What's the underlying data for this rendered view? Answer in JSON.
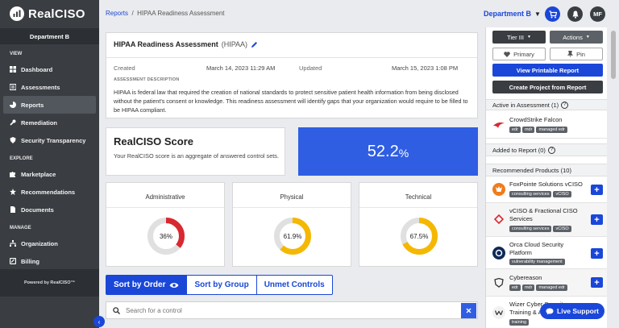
{
  "brand": {
    "name": "RealCISO"
  },
  "sidebar": {
    "department": "Department B",
    "sections": [
      {
        "label": "VIEW",
        "items": [
          {
            "label": "Dashboard",
            "icon": "dashboard-icon"
          },
          {
            "label": "Assessments",
            "icon": "list-icon"
          },
          {
            "label": "Reports",
            "icon": "chart-pie-icon",
            "active": true
          },
          {
            "label": "Remediation",
            "icon": "wrench-icon"
          },
          {
            "label": "Security Transparency",
            "icon": "shield-icon"
          }
        ]
      },
      {
        "label": "EXPLORE",
        "items": [
          {
            "label": "Marketplace",
            "icon": "puzzle-icon"
          },
          {
            "label": "Recommendations",
            "icon": "star-icon"
          },
          {
            "label": "Documents",
            "icon": "document-icon"
          }
        ]
      },
      {
        "label": "MANAGE",
        "items": [
          {
            "label": "Organization",
            "icon": "organization-icon"
          },
          {
            "label": "Billing",
            "icon": "billing-icon"
          }
        ]
      }
    ],
    "powered_by": "Powered by RealCISO™"
  },
  "topbar": {
    "breadcrumb_root": "Reports",
    "breadcrumb_sep": "/",
    "breadcrumb_current": "HIPAA Readiness Assessment",
    "department": "Department B",
    "avatar_initials": "MF"
  },
  "report": {
    "title": "HIPAA Readiness Assessment",
    "abbr": "(HIPAA)",
    "created_label": "Created",
    "created_value": "March 14, 2023 11:29 AM",
    "updated_label": "Updated",
    "updated_value": "March 15, 2023 1:08 PM",
    "description_label": "ASSESSMENT DESCRIPTION",
    "description": "HIPAA is federal law that required the creation of national standards to protect sensitive patient health information from being disclosed without the patient's consent or knowledge. This readiness assessment will identify gaps that your organization would require to be filled to be HIPAA compliant."
  },
  "score": {
    "title": "RealCISO Score",
    "description": "Your RealCISO score is an aggregate of answered control sets.",
    "value": "52.2",
    "unit": "%"
  },
  "categories": [
    {
      "name": "Administrative",
      "value": 36,
      "label": "36%",
      "color": "#d9282f"
    },
    {
      "name": "Physical",
      "value": 61.9,
      "label": "61.9%",
      "color": "#f5b800"
    },
    {
      "name": "Technical",
      "value": 67.5,
      "label": "67.5%",
      "color": "#f5b800"
    }
  ],
  "tabs": [
    {
      "label": "Sort by Order",
      "active": true
    },
    {
      "label": "Sort by Group",
      "active": false
    },
    {
      "label": "Unmet Controls",
      "active": false
    }
  ],
  "search": {
    "placeholder": "Search for a control"
  },
  "right_panel": {
    "tier_label": "Tier III",
    "actions_label": "Actions",
    "primary_label": "Primary",
    "pin_label": "Pin",
    "printable_label": "View Printable Report",
    "create_project_label": "Create Project from Report",
    "active_heading": "Active in Assessment (1)",
    "active_products": [
      {
        "name": "CrowdStrike Falcon",
        "tags": [
          "edr",
          "mdr",
          "managed edr"
        ]
      }
    ],
    "added_heading": "Added to Report (0)",
    "recommended_heading": "Recommended Products (10)",
    "recommended": [
      {
        "name": "FoxPointe Solutions vCISO",
        "tags": [
          "consulting services",
          "vCISO"
        ]
      },
      {
        "name": "vCISO & Fractional CISO Services",
        "tags": [
          "consulting services",
          "vCISO"
        ]
      },
      {
        "name": "Orca Cloud Security Platform",
        "tags": [
          "vulnerability management"
        ]
      },
      {
        "name": "Cybereason",
        "tags": [
          "edr",
          "mdr",
          "managed edr"
        ]
      },
      {
        "name": "Wizer Cyber Security Training & Awareness",
        "tags": [
          "training"
        ]
      }
    ]
  },
  "live_support": {
    "label": "Live Support"
  },
  "colors": {
    "accent": "#1a47d8",
    "sidebar": "#3a3d42",
    "score_bg": "#2f5ee3"
  }
}
